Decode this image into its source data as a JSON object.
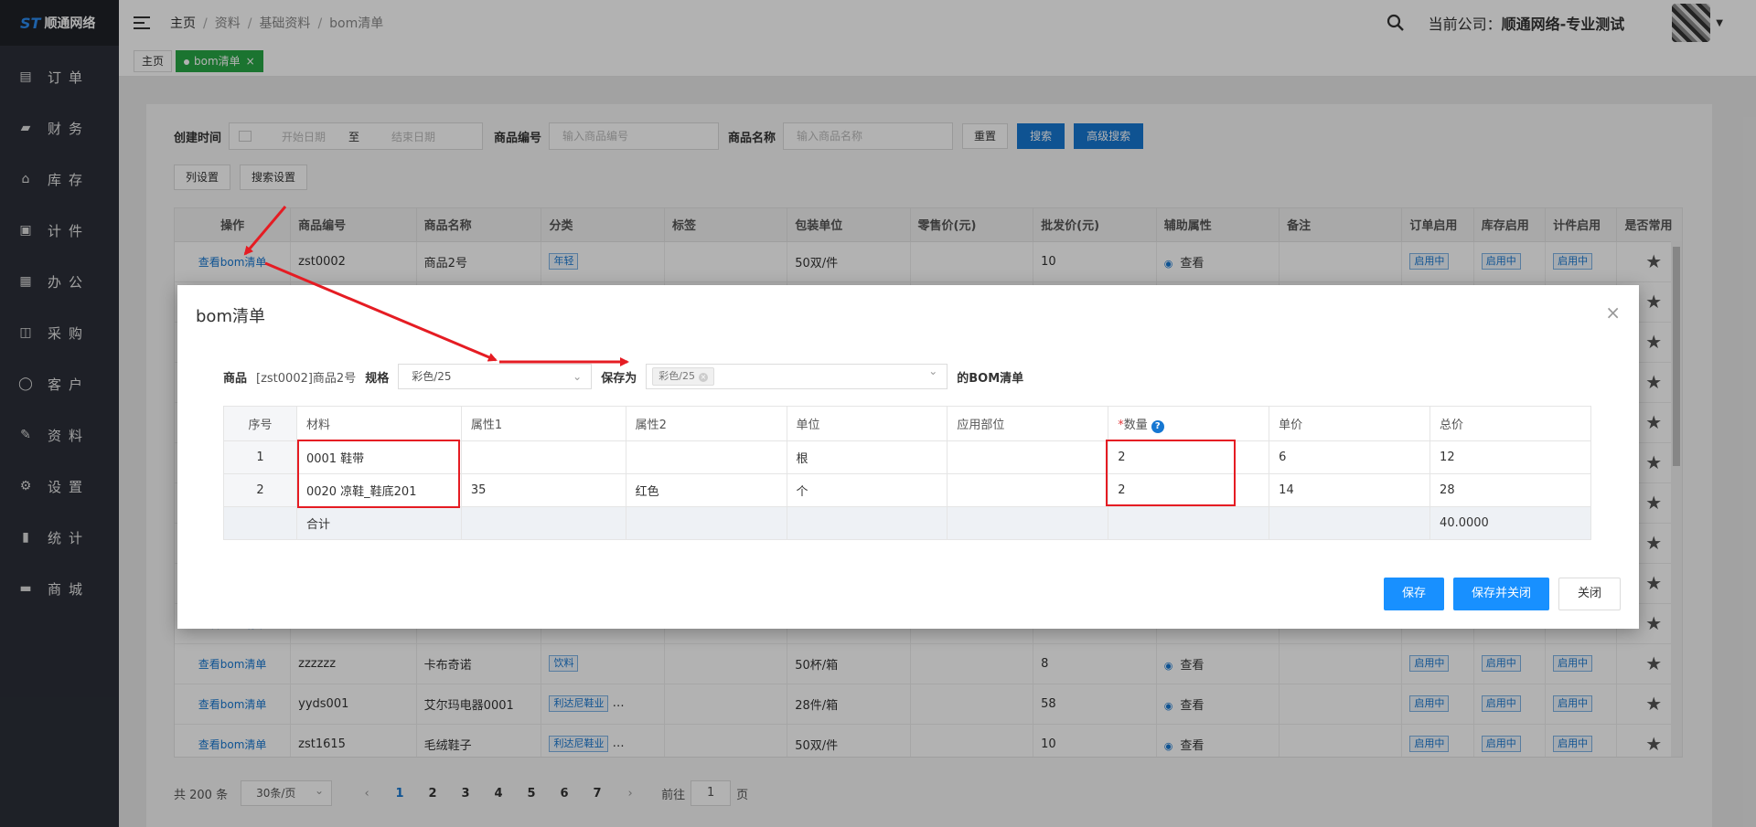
{
  "app": {
    "logo_text": "顺通网络",
    "logo_mark": "ST"
  },
  "sidebar": {
    "items": [
      {
        "label": "订单",
        "icon": "order-icon"
      },
      {
        "label": "财务",
        "icon": "finance-icon"
      },
      {
        "label": "库存",
        "icon": "home-icon"
      },
      {
        "label": "计件",
        "icon": "clipboard-icon"
      },
      {
        "label": "办公",
        "icon": "calendar-icon"
      },
      {
        "label": "采购",
        "icon": "bag-icon"
      },
      {
        "label": "客户",
        "icon": "user-icon"
      },
      {
        "label": "资料",
        "icon": "pen-icon"
      },
      {
        "label": "设置",
        "icon": "gear-icon"
      },
      {
        "label": "统计",
        "icon": "bar-chart-icon"
      },
      {
        "label": "商城",
        "icon": "store-icon"
      }
    ]
  },
  "header": {
    "breadcrumb": [
      "主页",
      "资料",
      "基础资料",
      "bom清单"
    ],
    "company_label": "当前公司：",
    "company_name": "顺通网络-专业测试"
  },
  "tabs": [
    {
      "label": "主页"
    },
    {
      "label": "bom清单"
    }
  ],
  "filters": {
    "create_time_label": "创建时间",
    "start_placeholder": "开始日期",
    "to_label": "至",
    "end_placeholder": "结束日期",
    "code_label": "商品编号",
    "code_placeholder": "输入商品编号",
    "name_label": "商品名称",
    "name_placeholder": "输入商品名称",
    "reset": "重置",
    "search": "搜索",
    "advanced": "高级搜索",
    "column_settings": "列设置",
    "search_settings": "搜索设置"
  },
  "table": {
    "columns": [
      "操作",
      "商品编号",
      "商品名称",
      "分类",
      "标签",
      "包装单位",
      "零售价(元)",
      "批发价(元)",
      "辅助属性",
      "备注",
      "订单启用",
      "库存启用",
      "计件启用",
      "是否常用"
    ],
    "op_label": "查看bom清单",
    "view_label": "查看",
    "enabled_label": "启用中",
    "rows_top": [
      {
        "code": "zst0002",
        "name": "商品2号",
        "category": "年轻",
        "unit": "50双/件",
        "wholesale": "10"
      }
    ],
    "rows_bottom": [
      {
        "code": "zzzzzz",
        "name": "卡布奇诺",
        "category": "饮料",
        "unit": "50杯/箱",
        "wholesale": "8"
      },
      {
        "code": "yyds001",
        "name": "艾尔玛电器0001",
        "category": "利达尼鞋业",
        "unit": "28件/箱",
        "wholesale": "58"
      },
      {
        "code": "zst1615",
        "name": "毛绒鞋子",
        "category": "利达尼鞋业",
        "unit": "50双/件",
        "wholesale": "10"
      }
    ]
  },
  "pager": {
    "total": "共 200 条",
    "page_size": "30条/页",
    "pages": [
      "1",
      "2",
      "3",
      "4",
      "5",
      "6",
      "7"
    ],
    "current": "1",
    "goto_label": "前往",
    "goto_value": "1",
    "page_suffix": "页"
  },
  "modal": {
    "title": "bom清单",
    "product_label": "商品",
    "product_value": "[zst0002]商品2号",
    "spec_label": "规格",
    "spec_value": "彩色/25",
    "save_as_label": "保存为",
    "save_as_chip": "彩色/25",
    "suffix_label": "的BOM清单",
    "columns": [
      "序号",
      "材料",
      "属性1",
      "属性2",
      "单位",
      "应用部位",
      "数量",
      "单价",
      "总价"
    ],
    "qty_required_mark": "*",
    "rows": [
      {
        "idx": "1",
        "material": "0001 鞋带",
        "attr1": "",
        "attr2": "",
        "unit": "根",
        "part": "",
        "qty": "2",
        "price": "6",
        "total": "12"
      },
      {
        "idx": "2",
        "material": "0020 凉鞋_鞋底201",
        "attr1": "35",
        "attr2": "红色",
        "unit": "个",
        "part": "",
        "qty": "2",
        "price": "14",
        "total": "28"
      }
    ],
    "sum_label": "合计",
    "sum_total": "40.0000",
    "buttons": {
      "save": "保存",
      "save_close": "保存并关闭",
      "close": "关闭"
    }
  },
  "colors": {
    "sidebar_bg": "#2b2f38",
    "primary": "#1890ff",
    "tab_active": "#28a745",
    "annotation_red": "#e51c23"
  }
}
